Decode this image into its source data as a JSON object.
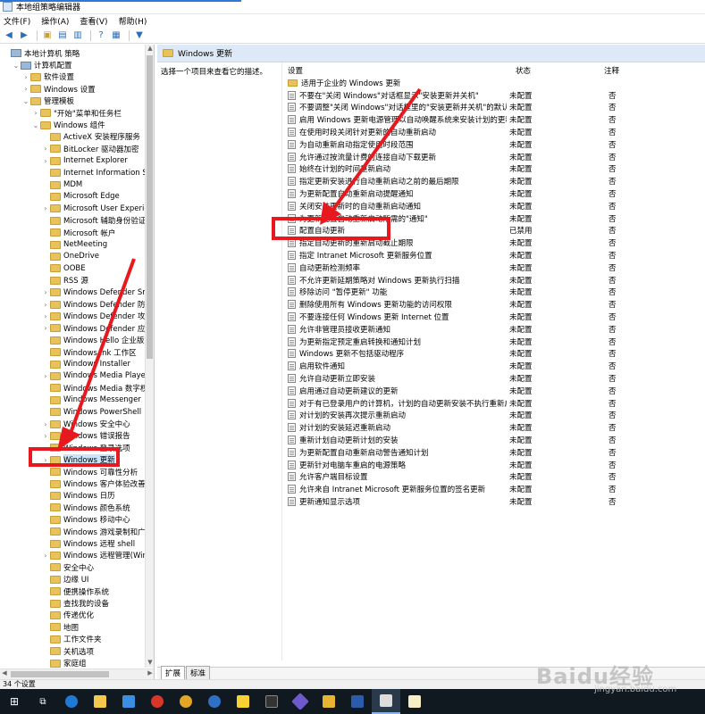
{
  "window": {
    "title": "本地组策略编辑器"
  },
  "menu": [
    "文件(F)",
    "操作(A)",
    "查看(V)",
    "帮助(H)"
  ],
  "toolbar": {
    "buttons": [
      "back-icon",
      "forward-icon",
      "folder-up-icon",
      "show-hide-tree-icon",
      "export-icon",
      "help-icon",
      "properties-icon",
      "filter-icon"
    ]
  },
  "tree": {
    "rows": [
      {
        "label": "本地计算机 策略",
        "indent": 0,
        "exp": "",
        "icon": "pc"
      },
      {
        "label": "计算机配置",
        "indent": 1,
        "exp": "⌄",
        "icon": "pc"
      },
      {
        "label": "软件设置",
        "indent": 2,
        "exp": "›",
        "icon": "folder"
      },
      {
        "label": "Windows 设置",
        "indent": 2,
        "exp": "›",
        "icon": "folder"
      },
      {
        "label": "管理模板",
        "indent": 2,
        "exp": "⌄",
        "icon": "folder"
      },
      {
        "label": "\"开始\"菜单和任务栏",
        "indent": 3,
        "exp": "›",
        "icon": "folder"
      },
      {
        "label": "Windows 组件",
        "indent": 3,
        "exp": "⌄",
        "icon": "folder"
      },
      {
        "label": "ActiveX 安装程序服务",
        "indent": 4,
        "exp": "",
        "icon": "folder"
      },
      {
        "label": "BitLocker 驱动器加密",
        "indent": 4,
        "exp": "›",
        "icon": "folder"
      },
      {
        "label": "Internet Explorer",
        "indent": 4,
        "exp": "›",
        "icon": "folder"
      },
      {
        "label": "Internet Information Ser",
        "indent": 4,
        "exp": "",
        "icon": "folder"
      },
      {
        "label": "MDM",
        "indent": 4,
        "exp": "",
        "icon": "folder"
      },
      {
        "label": "Microsoft Edge",
        "indent": 4,
        "exp": "",
        "icon": "folder"
      },
      {
        "label": "Microsoft User Experien",
        "indent": 4,
        "exp": "›",
        "icon": "folder"
      },
      {
        "label": "Microsoft 辅助身份验证因",
        "indent": 4,
        "exp": "",
        "icon": "folder"
      },
      {
        "label": "Microsoft 帐户",
        "indent": 4,
        "exp": "",
        "icon": "folder"
      },
      {
        "label": "NetMeeting",
        "indent": 4,
        "exp": "",
        "icon": "folder"
      },
      {
        "label": "OneDrive",
        "indent": 4,
        "exp": "",
        "icon": "folder"
      },
      {
        "label": "OOBE",
        "indent": 4,
        "exp": "",
        "icon": "folder"
      },
      {
        "label": "RSS 源",
        "indent": 4,
        "exp": "",
        "icon": "folder"
      },
      {
        "label": "Windows Defender Sma",
        "indent": 4,
        "exp": "›",
        "icon": "folder"
      },
      {
        "label": "Windows Defender 防病",
        "indent": 4,
        "exp": "›",
        "icon": "folder"
      },
      {
        "label": "Windows Defender 攻击",
        "indent": 4,
        "exp": "›",
        "icon": "folder"
      },
      {
        "label": "Windows Defender 应用",
        "indent": 4,
        "exp": "›",
        "icon": "folder"
      },
      {
        "label": "Windows Hello 企业版",
        "indent": 4,
        "exp": "",
        "icon": "folder"
      },
      {
        "label": "Windows Ink 工作区",
        "indent": 4,
        "exp": "",
        "icon": "folder"
      },
      {
        "label": "Windows Installer",
        "indent": 4,
        "exp": "",
        "icon": "folder"
      },
      {
        "label": "Windows Media Player",
        "indent": 4,
        "exp": "›",
        "icon": "folder"
      },
      {
        "label": "Windows Media 数字权限",
        "indent": 4,
        "exp": "",
        "icon": "folder"
      },
      {
        "label": "Windows Messenger",
        "indent": 4,
        "exp": "",
        "icon": "folder"
      },
      {
        "label": "Windows PowerShell",
        "indent": 4,
        "exp": "",
        "icon": "folder"
      },
      {
        "label": "Windows 安全中心",
        "indent": 4,
        "exp": "›",
        "icon": "folder"
      },
      {
        "label": "Windows 错误报告",
        "indent": 4,
        "exp": "›",
        "icon": "folder"
      },
      {
        "label": "Windows 登录选项",
        "indent": 4,
        "exp": "",
        "icon": "folder"
      },
      {
        "label": "Windows 更新",
        "indent": 4,
        "exp": "›",
        "icon": "folder",
        "selected": true
      },
      {
        "label": "Windows 可靠性分析",
        "indent": 4,
        "exp": "",
        "icon": "folder"
      },
      {
        "label": "Windows 客户体验改善计",
        "indent": 4,
        "exp": "",
        "icon": "folder"
      },
      {
        "label": "Windows 日历",
        "indent": 4,
        "exp": "",
        "icon": "folder"
      },
      {
        "label": "Windows 颜色系统",
        "indent": 4,
        "exp": "",
        "icon": "folder"
      },
      {
        "label": "Windows 移动中心",
        "indent": 4,
        "exp": "",
        "icon": "folder"
      },
      {
        "label": "Windows 游戏录制和广播",
        "indent": 4,
        "exp": "",
        "icon": "folder"
      },
      {
        "label": "Windows 远程 shell",
        "indent": 4,
        "exp": "",
        "icon": "folder"
      },
      {
        "label": "Windows 远程管理(WinR",
        "indent": 4,
        "exp": "›",
        "icon": "folder"
      },
      {
        "label": "安全中心",
        "indent": 4,
        "exp": "",
        "icon": "folder"
      },
      {
        "label": "边缘 UI",
        "indent": 4,
        "exp": "",
        "icon": "folder"
      },
      {
        "label": "便携操作系统",
        "indent": 4,
        "exp": "",
        "icon": "folder"
      },
      {
        "label": "查找我的设备",
        "indent": 4,
        "exp": "",
        "icon": "folder"
      },
      {
        "label": "传递优化",
        "indent": 4,
        "exp": "",
        "icon": "folder"
      },
      {
        "label": "地图",
        "indent": 4,
        "exp": "",
        "icon": "folder"
      },
      {
        "label": "工作文件夹",
        "indent": 4,
        "exp": "",
        "icon": "folder"
      },
      {
        "label": "关机选项",
        "indent": 4,
        "exp": "",
        "icon": "folder"
      },
      {
        "label": "家庭组",
        "indent": 4,
        "exp": "",
        "icon": "folder"
      }
    ]
  },
  "details": {
    "header_title": "Windows 更新",
    "description_hint": "选择一个项目来查看它的描述。",
    "columns": {
      "setting": "设置",
      "state": "状态",
      "note": "注释"
    },
    "rows": [
      {
        "name": "适用于企业的 Windows 更新",
        "state": "",
        "note": "",
        "type": "folder"
      },
      {
        "name": "不要在\"关闭 Windows\"对话框显示\"安装更新并关机\"",
        "state": "未配置",
        "note": "否",
        "type": "policy"
      },
      {
        "name": "不要调整\"关闭 Windows\"对话框里的\"安装更新并关机\"的默认选项",
        "state": "未配置",
        "note": "否",
        "type": "policy"
      },
      {
        "name": "启用 Windows 更新电源管理以自动唤醒系统来安装计划的更新",
        "state": "未配置",
        "note": "否",
        "type": "policy"
      },
      {
        "name": "在使用时段关闭针对更新的自动重新启动",
        "state": "未配置",
        "note": "否",
        "type": "policy"
      },
      {
        "name": "为自动重新启动指定使用时段范围",
        "state": "未配置",
        "note": "否",
        "type": "policy"
      },
      {
        "name": "允许通过按流量计费的连接自动下载更新",
        "state": "未配置",
        "note": "否",
        "type": "policy"
      },
      {
        "name": "始终在计划的时间重新启动",
        "state": "未配置",
        "note": "否",
        "type": "policy"
      },
      {
        "name": "指定更新安装进行自动重新启动之前的最后期限",
        "state": "未配置",
        "note": "否",
        "type": "policy"
      },
      {
        "name": "为更新配置自动重新启动提醒通知",
        "state": "未配置",
        "note": "否",
        "type": "policy"
      },
      {
        "name": "关闭安装更新时的自动重新启动通知",
        "state": "未配置",
        "note": "否",
        "type": "policy"
      },
      {
        "name": "为更新配置自动重新启动所需的\"通知\"",
        "state": "未配置",
        "note": "否",
        "type": "policy"
      },
      {
        "name": "配置自动更新",
        "state": "已禁用",
        "note": "否",
        "type": "policy"
      },
      {
        "name": "指定自动更新的重新启动截止期限",
        "state": "未配置",
        "note": "否",
        "type": "policy"
      },
      {
        "name": "指定 Intranet Microsoft 更新服务位置",
        "state": "未配置",
        "note": "否",
        "type": "policy"
      },
      {
        "name": "自动更新检测频率",
        "state": "未配置",
        "note": "否",
        "type": "policy"
      },
      {
        "name": "不允许更新延期策略对 Windows 更新执行扫描",
        "state": "未配置",
        "note": "否",
        "type": "policy"
      },
      {
        "name": "移除访问 \"暂停更新\" 功能",
        "state": "未配置",
        "note": "否",
        "type": "policy"
      },
      {
        "name": "删除使用所有 Windows 更新功能的访问权限",
        "state": "未配置",
        "note": "否",
        "type": "policy"
      },
      {
        "name": "不要连接任何 Windows 更新 Internet 位置",
        "state": "未配置",
        "note": "否",
        "type": "policy"
      },
      {
        "name": "允许非管理员接收更新通知",
        "state": "未配置",
        "note": "否",
        "type": "policy"
      },
      {
        "name": "为更新指定预定重启转换和通知计划",
        "state": "未配置",
        "note": "否",
        "type": "policy"
      },
      {
        "name": "Windows 更新不包括驱动程序",
        "state": "未配置",
        "note": "否",
        "type": "policy"
      },
      {
        "name": "启用软件通知",
        "state": "未配置",
        "note": "否",
        "type": "policy"
      },
      {
        "name": "允许自动更新立即安装",
        "state": "未配置",
        "note": "否",
        "type": "policy"
      },
      {
        "name": "启用通过自动更新建议的更新",
        "state": "未配置",
        "note": "否",
        "type": "policy"
      },
      {
        "name": "对于有已登录用户的计算机，计划的自动更新安装不执行重新启动",
        "state": "未配置",
        "note": "否",
        "type": "policy"
      },
      {
        "name": "对计划的安装再次提示重新启动",
        "state": "未配置",
        "note": "否",
        "type": "policy"
      },
      {
        "name": "对计划的安装延迟重新启动",
        "state": "未配置",
        "note": "否",
        "type": "policy"
      },
      {
        "name": "重新计划自动更新计划的安装",
        "state": "未配置",
        "note": "否",
        "type": "policy"
      },
      {
        "name": "为更新配置自动重新启动警告通知计划",
        "state": "未配置",
        "note": "否",
        "type": "policy"
      },
      {
        "name": "更新针对电脑车重启的电源策略",
        "state": "未配置",
        "note": "否",
        "type": "policy"
      },
      {
        "name": "允许客户端目标设置",
        "state": "未配置",
        "note": "否",
        "type": "policy"
      },
      {
        "name": "允许来自 Intranet Microsoft 更新服务位置的签名更新",
        "state": "未配置",
        "note": "否",
        "type": "policy"
      },
      {
        "name": "更新通知显示选项",
        "state": "未配置",
        "note": "否",
        "type": "policy"
      }
    ]
  },
  "tabs": [
    "扩展",
    "标准"
  ],
  "status": "34 个设置",
  "taskbar": {
    "items": [
      "windows-start-icon",
      "task-view-icon",
      "edge-icon",
      "file-explorer-icon",
      "store-icon",
      "app-icon",
      "chrome-icon",
      "ie-search-icon",
      "sticky-icon",
      "terminal-icon",
      "app2-icon",
      "app3-icon",
      "word-icon",
      "gpedit-icon",
      "notepad-icon"
    ]
  },
  "watermark": {
    "main": "Baidu经验",
    "sub": "jingyan.baidu.com"
  },
  "colors": {
    "accent": "#2b78d8",
    "highlight": "#e8191e",
    "header_bg": "#dde9f6",
    "taskbar": "#101820"
  }
}
